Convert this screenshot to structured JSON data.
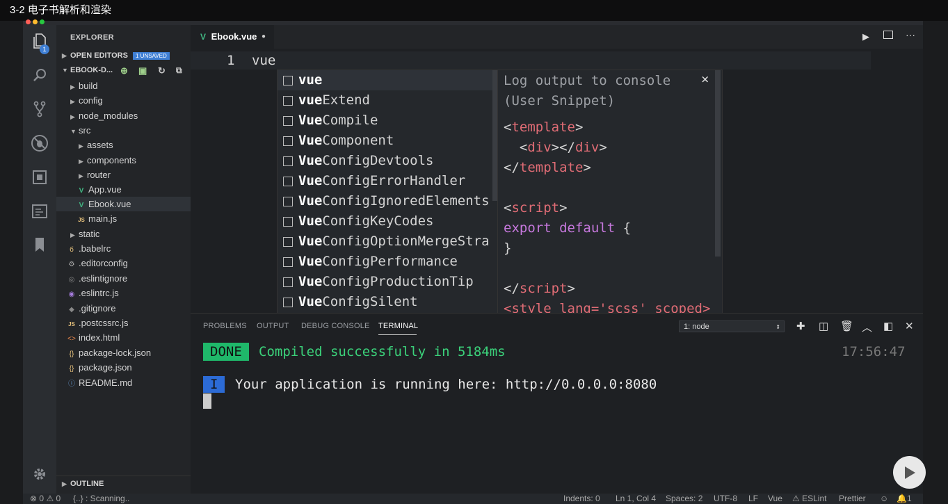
{
  "window": {
    "title": "3-2 电子书解析和渲染"
  },
  "activity_bar": {
    "badge": "1"
  },
  "sidebar": {
    "header": "EXPLORER",
    "open_editors": {
      "label": "OPEN EDITORS",
      "badge": "1 UNSAVED"
    },
    "project": {
      "label": "EBOOK-D..."
    },
    "tree": [
      {
        "name": "build"
      },
      {
        "name": "config"
      },
      {
        "name": "node_modules"
      },
      {
        "name": "src"
      },
      {
        "name": "assets"
      },
      {
        "name": "components"
      },
      {
        "name": "router"
      },
      {
        "name": "App.vue"
      },
      {
        "name": "Ebook.vue"
      },
      {
        "name": "main.js"
      },
      {
        "name": "static"
      },
      {
        "name": ".babelrc"
      },
      {
        "name": ".editorconfig"
      },
      {
        "name": ".eslintignore"
      },
      {
        "name": ".eslintrc.js"
      },
      {
        "name": ".gitignore"
      },
      {
        "name": ".postcssrc.js"
      },
      {
        "name": "index.html"
      },
      {
        "name": "package-lock.json"
      },
      {
        "name": "package.json"
      },
      {
        "name": "README.md"
      }
    ],
    "outline": "OUTLINE"
  },
  "editor": {
    "tab_label": "Ebook.vue",
    "line_number": "1",
    "line_text": "vue",
    "suggestions": [
      {
        "match": "vue",
        "rest": ""
      },
      {
        "match": "vue",
        "rest": "Extend"
      },
      {
        "match": "Vue",
        "rest": "Compile"
      },
      {
        "match": "Vue",
        "rest": "Component"
      },
      {
        "match": "Vue",
        "rest": "ConfigDevtools"
      },
      {
        "match": "Vue",
        "rest": "ConfigErrorHandler"
      },
      {
        "match": "Vue",
        "rest": "ConfigIgnoredElements"
      },
      {
        "match": "Vue",
        "rest": "ConfigKeyCodes"
      },
      {
        "match": "Vue",
        "rest": "ConfigOptionMergeStra"
      },
      {
        "match": "Vue",
        "rest": "ConfigPerformance"
      },
      {
        "match": "Vue",
        "rest": "ConfigProductionTip"
      },
      {
        "match": "Vue",
        "rest": "ConfigSilent"
      }
    ],
    "detail": {
      "title": "Log output to console",
      "subtitle": "(User Snippet)",
      "close": "×",
      "tpl_open": "template",
      "div_open": "div",
      "div_close": "div",
      "tpl_close": "template",
      "script_open": "script",
      "export_kw": "export",
      "default_kw": "default",
      "brace_open": "{",
      "brace_close": "}",
      "script_close": "script",
      "style_line": "<style lang='scss' scoped>"
    }
  },
  "panel": {
    "tabs": [
      "PROBLEMS",
      "OUTPUT",
      "DEBUG CONSOLE",
      "TERMINAL"
    ],
    "terminal_select": "1: node",
    "done_badge": "DONE",
    "compiled_msg": "Compiled successfully in 5184ms",
    "timestamp": "17:56:47",
    "info_badge": "I",
    "running_msg": "Your application is running here: http://0.0.0.0:8080"
  },
  "statusbar": {
    "errors": "0",
    "warnings": "0",
    "scanning": "{..} : Scanning..",
    "indents": "Indents: 0",
    "position": "Ln 1, Col 4",
    "spaces": "Spaces: 2",
    "encoding": "UTF-8",
    "eol": "LF",
    "language": "Vue",
    "eslint": "ESLint",
    "prettier": "Prettier",
    "notifications": "1"
  },
  "colors": {
    "accent_green": "#42b883",
    "done_bg": "#1fb86a",
    "info_bg": "#2c6bd6",
    "badge_blue": "#3f7fd4"
  }
}
